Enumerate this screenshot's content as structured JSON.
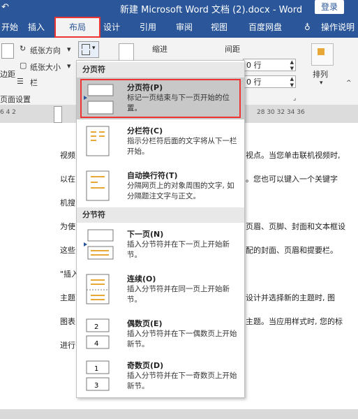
{
  "window": {
    "title": "新建 Microsoft Word 文档 (2).docx - Word",
    "login_label": "登录",
    "qa_icon": "undo-icon"
  },
  "tabs": [
    {
      "label": "开始",
      "active": false
    },
    {
      "label": "插入",
      "active": false
    },
    {
      "label": "布局",
      "active": true
    },
    {
      "label": "设计",
      "active": false
    },
    {
      "label": "引用",
      "active": false
    },
    {
      "label": "审阅",
      "active": false
    },
    {
      "label": "视图",
      "active": false
    },
    {
      "label": "百度网盘",
      "active": false
    },
    {
      "label": "操作说明",
      "active": false
    }
  ],
  "ribbon": {
    "orientation_label": "纸张方向",
    "size_label": "纸张大小",
    "columns_label": "栏",
    "margins_label": "边距",
    "page_setup_label": "页面设置",
    "indent_label": "缩进",
    "spacing_label": "间距",
    "spacing_before": "0 行",
    "spacing_after": "0 行",
    "arrange_label": "排列"
  },
  "ruler": {
    "marks": "6   4   2  ",
    "marks_right": "28  30  32  34  36"
  },
  "document": {
    "lines": [
      "视频",
      "以在",
      "机搜",
      "为使",
      "这些",
      "\"插入",
      "主题",
      "图表",
      "进行"
    ],
    "right_lines": [
      "视点。当您单击联机视频时,",
      "。您也可以键入一个关键字",
      "",
      "页眉、页脚、封面和文本框设",
      "配的封面、页眉和提要栏。",
      "",
      "设计并选择新的主题时, 图",
      "主题。当应用样式时, 您的标",
      ""
    ]
  },
  "dropdown": {
    "section_page": "分页符",
    "section_section": "分节符",
    "items": [
      {
        "title": "分页符(P)",
        "desc": "标记一页结束与下一页开始的位置。",
        "icon": "page-break-icon",
        "highlighted": true
      },
      {
        "title": "分栏符(C)",
        "desc": "指示分栏符后面的文字将从下一栏开始。",
        "icon": "column-break-icon",
        "highlighted": false
      },
      {
        "title": "自动换行符(T)",
        "desc": "分隔网页上的对象周围的文字, 如分隔题注文字与正文。",
        "icon": "text-wrapping-break-icon",
        "highlighted": false
      },
      {
        "title": "下一页(N)",
        "desc": "插入分节符并在下一页上开始新节。",
        "icon": "next-page-section-icon",
        "highlighted": false
      },
      {
        "title": "连续(O)",
        "desc": "插入分节符并在同一页上开始新节。",
        "icon": "continuous-section-icon",
        "highlighted": false
      },
      {
        "title": "偶数页(E)",
        "desc": "插入分节符并在下一偶数页上开始新节。",
        "icon": "even-page-section-icon",
        "highlighted": false
      },
      {
        "title": "奇数页(D)",
        "desc": "插入分节符并在下一奇数页上开始新节。",
        "icon": "odd-page-section-icon",
        "highlighted": false
      }
    ]
  },
  "colors": {
    "accent": "#2b579a",
    "highlight_border": "#ee3333"
  }
}
